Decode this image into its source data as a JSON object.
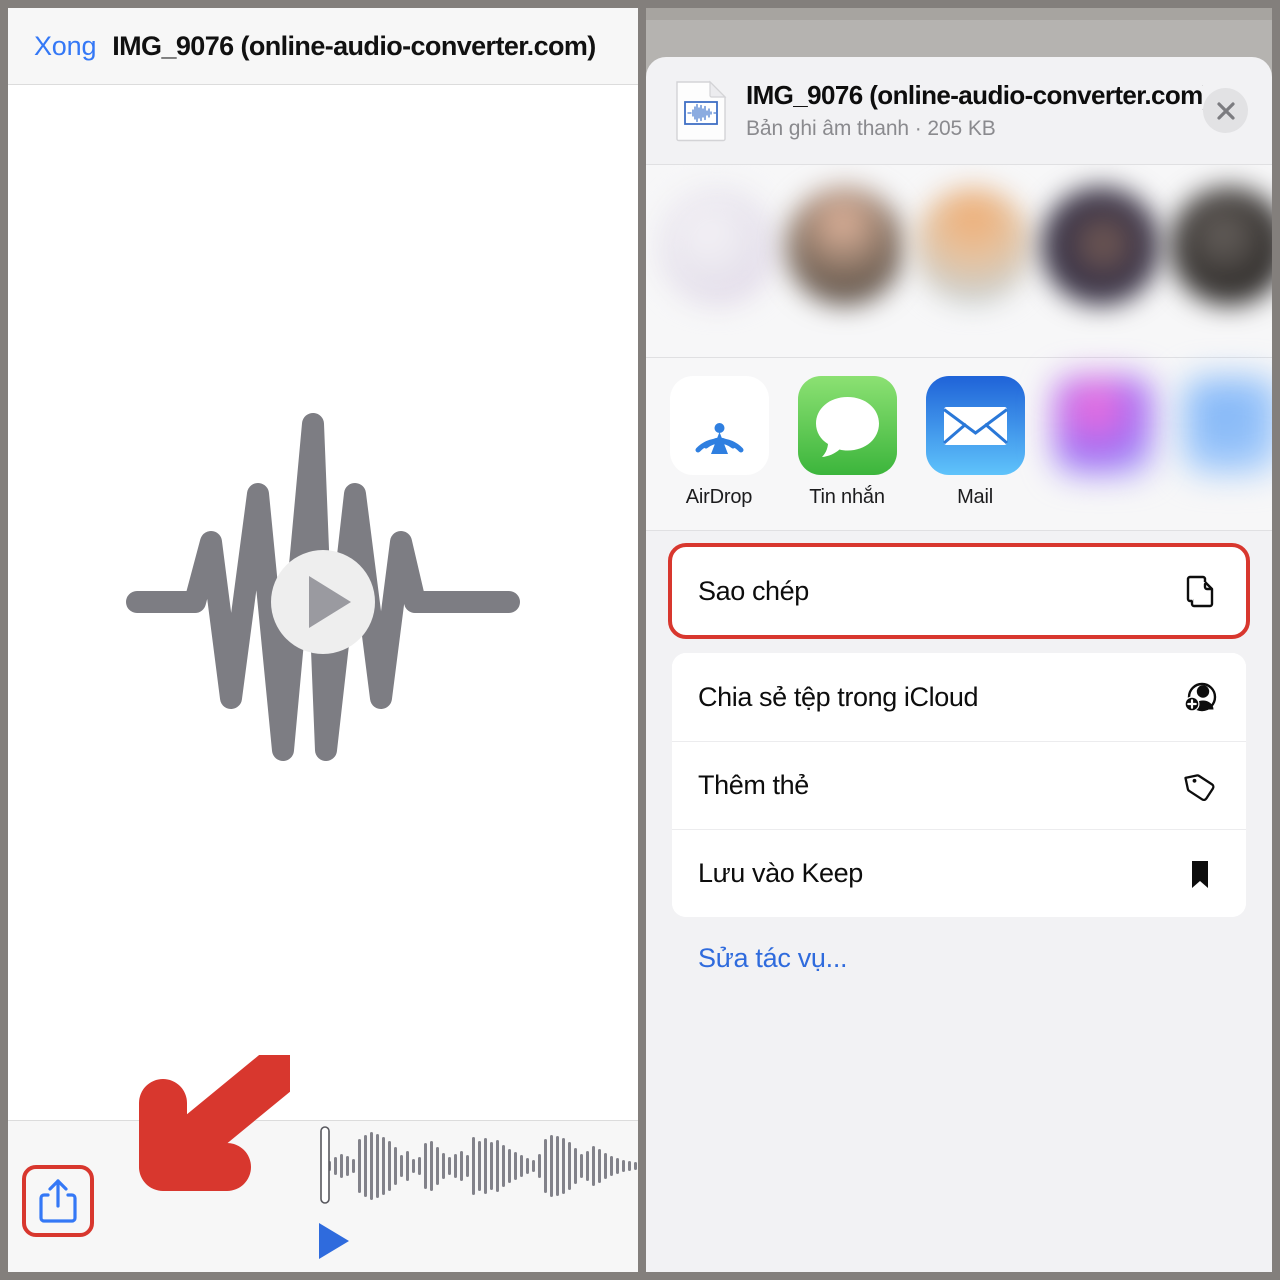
{
  "left": {
    "nav": {
      "done_label": "Xong",
      "title": "IMG_9076 (online-audio-converter.com)"
    },
    "toolbar": {
      "share_icon": "share-up-arrow-icon",
      "play_icon": "play-triangle-icon",
      "waveform_icon": "audio-waveform-scrubber"
    },
    "preview": {
      "icon": "audio-waveform-play-icon"
    },
    "annotation": {
      "arrow_icon": "red-arrow-pointing-down-left",
      "arrow_color": "#d8372e",
      "highlight_color": "#d8372e"
    }
  },
  "share_sheet": {
    "file": {
      "name": "IMG_9076 (online-audio-converter.com)",
      "subtitle": "Bản ghi âm thanh · 205 KB",
      "icon": "audio-file-icon"
    },
    "close_icon": "close-x-icon",
    "contacts": [
      {
        "name": "",
        "color1": "#eceaf0",
        "color2": "#dcd8e4"
      },
      {
        "name": "",
        "color1": "#6f6257",
        "color2": "#3a332c"
      },
      {
        "name": "",
        "color1": "#e8b184",
        "color2": "#b9d3e6"
      },
      {
        "name": "",
        "color1": "#3b3550",
        "color2": "#1d1b2c"
      },
      {
        "name": "",
        "color1": "#4a4a4a",
        "color2": "#222222"
      }
    ],
    "apps": [
      {
        "label": "AirDrop",
        "icon": "airdrop-icon",
        "blurred": false
      },
      {
        "label": "Tin nhắn",
        "icon": "messages-icon",
        "blurred": false
      },
      {
        "label": "Mail",
        "icon": "mail-icon",
        "blurred": false
      },
      {
        "label": "",
        "icon": "blurred-app-icon",
        "blurred": true
      },
      {
        "label": "",
        "icon": "blurred-app-icon",
        "blurred": true
      }
    ],
    "action_groups": [
      {
        "highlighted": true,
        "rows": [
          {
            "label": "Sao chép",
            "icon": "copy-documents-icon"
          }
        ]
      },
      {
        "highlighted": false,
        "rows": [
          {
            "label": "Chia sẻ tệp trong iCloud",
            "icon": "add-person-icon"
          },
          {
            "label": "Thêm thẻ",
            "icon": "tag-icon"
          },
          {
            "label": "Lưu vào Keep",
            "icon": "bookmark-icon"
          }
        ]
      }
    ],
    "edit_actions_label": "Sửa tác vụ..."
  },
  "colors": {
    "accent_blue": "#3478f6",
    "link_blue": "#2f6bdd",
    "annotation_red": "#d8372e",
    "backdrop_gray": "#837f7c"
  }
}
